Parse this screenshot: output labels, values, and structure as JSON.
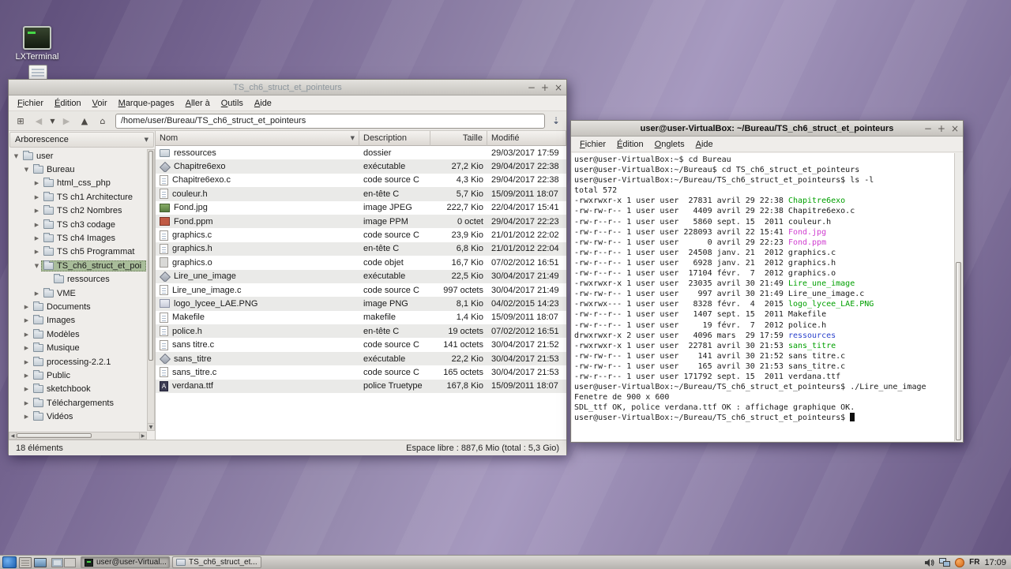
{
  "chrome": {
    "minimize": "−",
    "maximize": "+",
    "close": "×"
  },
  "desktop": {
    "icons": [
      {
        "label": "LXTerminal"
      }
    ]
  },
  "file_manager": {
    "title": "TS_ch6_struct_et_pointeurs",
    "menus": [
      "Fichier",
      "Édition",
      "Voir",
      "Marque-pages",
      "Aller à",
      "Outils",
      "Aide"
    ],
    "toolbar": {
      "buttons": [
        {
          "name": "new-tab",
          "glyph": "⊞",
          "enabled": true
        },
        {
          "name": "back",
          "glyph": "◀",
          "enabled": false
        },
        {
          "name": "history-dropdown",
          "glyph": "▼",
          "enabled": true,
          "small": true
        },
        {
          "name": "forward",
          "glyph": "▶",
          "enabled": false
        },
        {
          "name": "up",
          "glyph": "▲",
          "enabled": true
        },
        {
          "name": "home",
          "glyph": "⌂",
          "enabled": true
        }
      ],
      "path": "/home/user/Bureau/TS_ch6_struct_et_pointeurs",
      "go_button_glyph": "⇣"
    },
    "side_pane": {
      "mode_selector": "Arborescence",
      "selector_arrow": "▼",
      "tree": [
        {
          "label": "user",
          "level": 0,
          "exp": "open"
        },
        {
          "label": "Bureau",
          "level": 1,
          "exp": "open"
        },
        {
          "label": "html_css_php",
          "level": 2,
          "exp": "closed"
        },
        {
          "label": "TS ch1 Architecture",
          "level": 2,
          "exp": "closed"
        },
        {
          "label": "TS ch2 Nombres",
          "level": 2,
          "exp": "closed"
        },
        {
          "label": "TS ch3  codage",
          "level": 2,
          "exp": "closed"
        },
        {
          "label": "TS ch4  Images",
          "level": 2,
          "exp": "closed"
        },
        {
          "label": "TS ch5 Programmat",
          "level": 2,
          "exp": "closed"
        },
        {
          "label": "TS_ch6_struct_et_poi",
          "level": 2,
          "exp": "open",
          "selected": true
        },
        {
          "label": "ressources",
          "level": 3,
          "exp": "leaf"
        },
        {
          "label": "VME",
          "level": 2,
          "exp": "closed"
        },
        {
          "label": "Documents",
          "level": 1,
          "exp": "closed"
        },
        {
          "label": "Images",
          "level": 1,
          "exp": "closed"
        },
        {
          "label": "Modèles",
          "level": 1,
          "exp": "closed"
        },
        {
          "label": "Musique",
          "level": 1,
          "exp": "closed"
        },
        {
          "label": "processing-2.2.1",
          "level": 1,
          "exp": "closed"
        },
        {
          "label": "Public",
          "level": 1,
          "exp": "closed"
        },
        {
          "label": "sketchbook",
          "level": 1,
          "exp": "closed"
        },
        {
          "label": "Téléchargements",
          "level": 1,
          "exp": "closed"
        },
        {
          "label": "Vidéos",
          "level": 1,
          "exp": "closed"
        }
      ]
    },
    "list": {
      "columns": [
        "Nom",
        "Description",
        "Taille",
        "Modifié"
      ],
      "sort_indicator": "▼",
      "rows": [
        {
          "name": "ressources",
          "desc": "dossier",
          "size": "",
          "modified": "29/03/2017 17:59",
          "icon": "folder"
        },
        {
          "name": "Chapitre6exo",
          "desc": "exécutable",
          "size": "27,2 Kio",
          "modified": "29/04/2017 22:38",
          "icon": "exec"
        },
        {
          "name": "Chapitre6exo.c",
          "desc": "code source C",
          "size": "4,3 Kio",
          "modified": "29/04/2017 22:38",
          "icon": "code"
        },
        {
          "name": "couleur.h",
          "desc": "en-tête C",
          "size": "5,7 Kio",
          "modified": "15/09/2011 18:07",
          "icon": "code"
        },
        {
          "name": "Fond.jpg",
          "desc": "image JPEG",
          "size": "222,7 Kio",
          "modified": "22/04/2017 15:41",
          "icon": "img-green"
        },
        {
          "name": "Fond.ppm",
          "desc": "image PPM",
          "size": "0 octet",
          "modified": "29/04/2017 22:23",
          "icon": "img-red"
        },
        {
          "name": "graphics.c",
          "desc": "code source C",
          "size": "23,9 Kio",
          "modified": "21/01/2012 22:02",
          "icon": "code"
        },
        {
          "name": "graphics.h",
          "desc": "en-tête C",
          "size": "6,8 Kio",
          "modified": "21/01/2012 22:04",
          "icon": "code"
        },
        {
          "name": "graphics.o",
          "desc": "code objet",
          "size": "16,7 Kio",
          "modified": "07/02/2012 16:51",
          "icon": "obj"
        },
        {
          "name": "Lire_une_image",
          "desc": "exécutable",
          "size": "22,5 Kio",
          "modified": "30/04/2017 21:49",
          "icon": "exec"
        },
        {
          "name": "Lire_une_image.c",
          "desc": "code source C",
          "size": "997 octets",
          "modified": "30/04/2017 21:49",
          "icon": "code"
        },
        {
          "name": "logo_lycee_LAE.PNG",
          "desc": "image PNG",
          "size": "8,1 Kio",
          "modified": "04/02/2015 14:23",
          "icon": "img-light"
        },
        {
          "name": "Makefile",
          "desc": "makefile",
          "size": "1,4 Kio",
          "modified": "15/09/2011 18:07",
          "icon": "text"
        },
        {
          "name": "police.h",
          "desc": "en-tête C",
          "size": "19 octets",
          "modified": "07/02/2012 16:51",
          "icon": "code"
        },
        {
          "name": "sans titre.c",
          "desc": "code source C",
          "size": "141 octets",
          "modified": "30/04/2017 21:52",
          "icon": "code"
        },
        {
          "name": "sans_titre",
          "desc": "exécutable",
          "size": "22,2 Kio",
          "modified": "30/04/2017 21:53",
          "icon": "exec"
        },
        {
          "name": "sans_titre.c",
          "desc": "code source C",
          "size": "165 octets",
          "modified": "30/04/2017 21:53",
          "icon": "code"
        },
        {
          "name": "verdana.ttf",
          "desc": "police Truetype",
          "size": "167,8 Kio",
          "modified": "15/09/2011 18:07",
          "icon": "font"
        }
      ]
    },
    "statusbar": {
      "left": "18 éléments",
      "right": "Espace libre : 887,6 Mio (total : 5,3 Gio)"
    }
  },
  "terminal": {
    "title": "user@user-VirtualBox: ~/Bureau/TS_ch6_struct_et_pointeurs",
    "menus": [
      "Fichier",
      "Édition",
      "Onglets",
      "Aide"
    ],
    "colors": {
      "exec": "#00a000",
      "image": "#cf3ccf",
      "dir": "#2a41cc"
    },
    "lines": [
      [
        {
          "t": "user@user-VirtualBox:~$ cd Bureau"
        }
      ],
      [
        {
          "t": "user@user-VirtualBox:~/Bureau$ cd TS_ch6_struct_et_pointeurs"
        }
      ],
      [
        {
          "t": "user@user-VirtualBox:~/Bureau/TS_ch6_struct_et_pointeurs$ ls -l"
        }
      ],
      [
        {
          "t": "total 572"
        }
      ],
      [
        {
          "t": "-rwxrwxr-x 1 user user  27831 avril 29 22:38 "
        },
        {
          "t": "Chapitre6exo",
          "c": "exec"
        }
      ],
      [
        {
          "t": "-rw-rw-r-- 1 user user   4409 avril 29 22:38 Chapitre6exo.c"
        }
      ],
      [
        {
          "t": "-rw-r--r-- 1 user user   5860 sept. 15  2011 couleur.h"
        }
      ],
      [
        {
          "t": "-rw-r--r-- 1 user user 228093 avril 22 15:41 "
        },
        {
          "t": "Fond.jpg",
          "c": "image"
        }
      ],
      [
        {
          "t": "-rw-rw-r-- 1 user user      0 avril 29 22:23 "
        },
        {
          "t": "Fond.ppm",
          "c": "image"
        }
      ],
      [
        {
          "t": "-rw-r--r-- 1 user user  24508 janv. 21  2012 graphics.c"
        }
      ],
      [
        {
          "t": "-rw-r--r-- 1 user user   6928 janv. 21  2012 graphics.h"
        }
      ],
      [
        {
          "t": "-rw-r--r-- 1 user user  17104 févr.  7  2012 graphics.o"
        }
      ],
      [
        {
          "t": "-rwxrwxr-x 1 user user  23035 avril 30 21:49 "
        },
        {
          "t": "Lire_une_image",
          "c": "exec"
        }
      ],
      [
        {
          "t": "-rw-rw-r-- 1 user user    997 avril 30 21:49 Lire_une_image.c"
        }
      ],
      [
        {
          "t": "-rwxrwx--- 1 user user   8328 févr.  4  2015 "
        },
        {
          "t": "logo_lycee_LAE.PNG",
          "c": "exec"
        }
      ],
      [
        {
          "t": "-rw-r--r-- 1 user user   1407 sept. 15  2011 Makefile"
        }
      ],
      [
        {
          "t": "-rw-r--r-- 1 user user     19 févr.  7  2012 police.h"
        }
      ],
      [
        {
          "t": "drwxrwxr-x 2 user user   4096 mars  29 17:59 "
        },
        {
          "t": "ressources",
          "c": "dir"
        }
      ],
      [
        {
          "t": "-rwxrwxr-x 1 user user  22781 avril 30 21:53 "
        },
        {
          "t": "sans_titre",
          "c": "exec"
        }
      ],
      [
        {
          "t": "-rw-rw-r-- 1 user user    141 avril 30 21:52 sans titre.c"
        }
      ],
      [
        {
          "t": "-rw-rw-r-- 1 user user    165 avril 30 21:53 sans_titre.c"
        }
      ],
      [
        {
          "t": "-rw-r--r-- 1 user user 171792 sept. 15  2011 verdana.ttf"
        }
      ],
      [
        {
          "t": "user@user-VirtualBox:~/Bureau/TS_ch6_struct_et_pointeurs$ ./Lire_une_image"
        }
      ],
      [
        {
          "t": "Fenetre de 900 x 600"
        }
      ],
      [
        {
          "t": "SDL_ttf OK, police verdana.ttf OK : affichage graphique OK."
        }
      ],
      [
        {
          "t": "user@user-VirtualBox:~/Bureau/TS_ch6_struct_et_pointeurs$ ",
          "cursor": true
        }
      ]
    ]
  },
  "taskbar": {
    "tasks": [
      {
        "label": "user@user-Virtual...",
        "icon": "terminal",
        "active": true
      },
      {
        "label": "TS_ch6_struct_et...",
        "icon": "folder",
        "active": false
      }
    ],
    "pager_cells": 2,
    "tray": {
      "keyboard_layout": "FR",
      "clock": "17:09"
    }
  }
}
